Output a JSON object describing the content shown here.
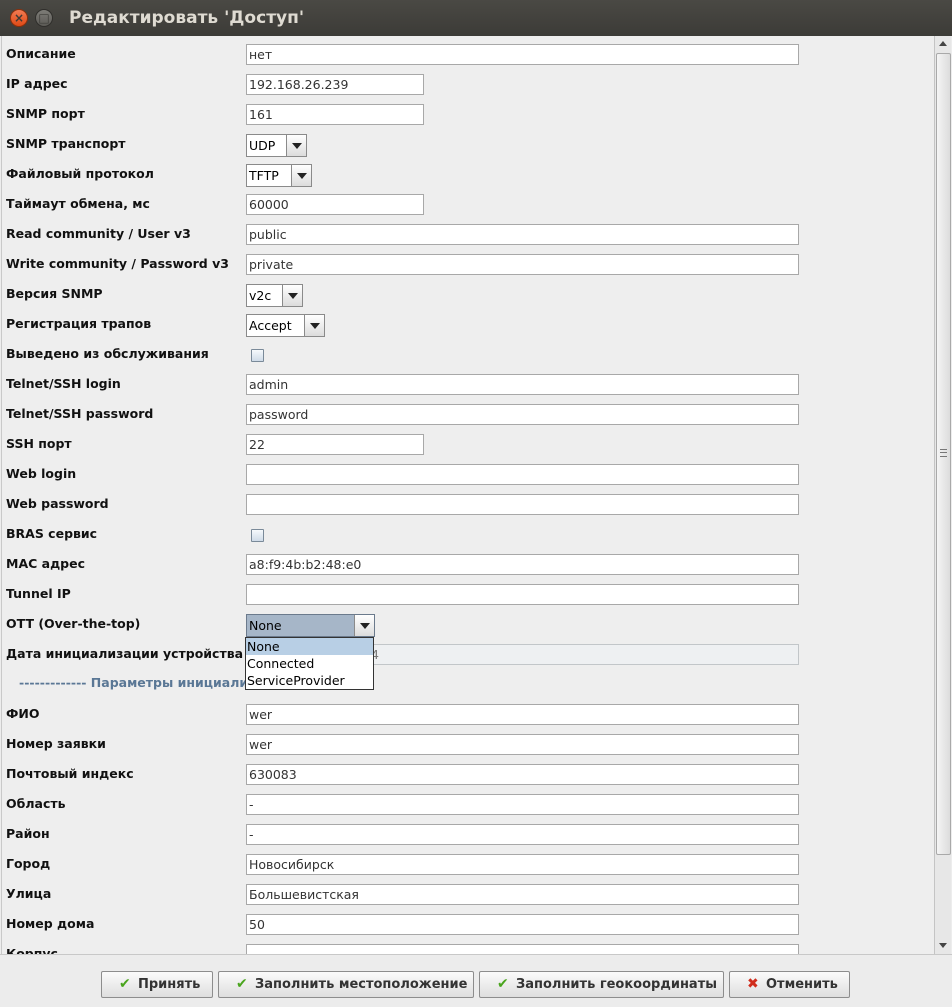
{
  "window": {
    "title": "Редактировать 'Доступ'"
  },
  "fields": [
    {
      "label": "Описание",
      "type": "text",
      "value": "нет"
    },
    {
      "label": "IP адрес",
      "type": "text",
      "value": "192.168.26.239"
    },
    {
      "label": "SNMP порт",
      "type": "text",
      "value": "161"
    },
    {
      "label": "SNMP транспорт",
      "type": "combo",
      "value": "UDP"
    },
    {
      "label": "Файловый протокол",
      "type": "combo",
      "value": "TFTP"
    },
    {
      "label": "Таймаут обмена, мс",
      "type": "text",
      "value": "60000"
    },
    {
      "label": "Read community / User v3",
      "type": "text",
      "value": "public"
    },
    {
      "label": "Write community / Password v3",
      "type": "text",
      "value": "private"
    },
    {
      "label": "Версия SNMP",
      "type": "combo",
      "value": "v2c"
    },
    {
      "label": "Регистрация трапов",
      "type": "combo",
      "value": "Accept"
    },
    {
      "label": "Выведено из обслуживания",
      "type": "checkbox",
      "checked": false
    },
    {
      "label": "Telnet/SSH login",
      "type": "text",
      "value": "admin"
    },
    {
      "label": "Telnet/SSH password",
      "type": "text",
      "value": "password"
    },
    {
      "label": "SSH порт",
      "type": "text",
      "value": "22"
    },
    {
      "label": "Web login",
      "type": "text",
      "value": ""
    },
    {
      "label": "Web password",
      "type": "text",
      "value": ""
    },
    {
      "label": "BRAS сервис",
      "type": "checkbox",
      "checked": false
    },
    {
      "label": "MAC адрес",
      "type": "text",
      "value": "a8:f9:4b:b2:48:e0"
    },
    {
      "label": "Tunnel IP",
      "type": "text",
      "value": ""
    },
    {
      "label": "OTT (Over-the-top)",
      "type": "combo",
      "value": "None",
      "options": [
        "None",
        "Connected",
        "ServiceProvider"
      ]
    },
    {
      "label": "Дата инициализации устройства",
      "type": "text-disabled",
      "value": "4"
    },
    {
      "label": "------------- Параметры инициализ",
      "type": "section"
    },
    {
      "label": "ФИО",
      "type": "text",
      "value": "wer"
    },
    {
      "label": "Номер заявки",
      "type": "text",
      "value": "wer"
    },
    {
      "label": "Почтовый индекс",
      "type": "text",
      "value": "630083"
    },
    {
      "label": "Область",
      "type": "text",
      "value": "-"
    },
    {
      "label": "Район",
      "type": "text",
      "value": "-"
    },
    {
      "label": "Город",
      "type": "text",
      "value": "Новосибирск"
    },
    {
      "label": "Улица",
      "type": "text",
      "value": "Большевистская"
    },
    {
      "label": "Номер дома",
      "type": "text",
      "value": "50"
    },
    {
      "label": "Корпус",
      "type": "text",
      "value": ""
    }
  ],
  "buttons": {
    "accept": "Принять",
    "fill_location": "Заполнить местоположение",
    "fill_geo": "Заполнить геокоординаты",
    "cancel": "Отменить"
  },
  "colors": {
    "accept_icon": "#4aa51e",
    "cancel_icon": "#d02c1c",
    "section_text": "#5a7795",
    "selected_option": "#b8cfe5"
  }
}
